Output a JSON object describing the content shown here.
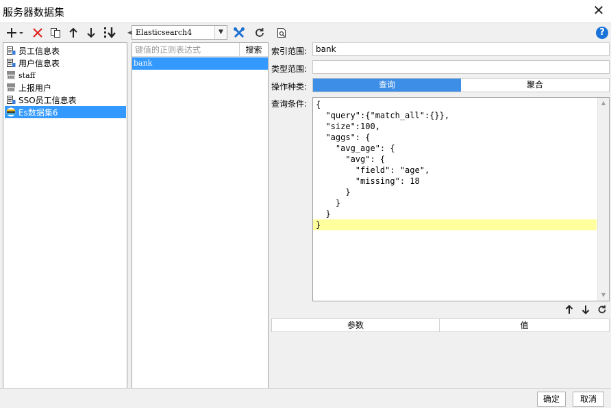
{
  "window": {
    "title": "服务器数据集"
  },
  "datasets": [
    {
      "label": "员工信息表",
      "icon": "table-icon"
    },
    {
      "label": "用户信息表",
      "icon": "table-icon"
    },
    {
      "label": "staff",
      "icon": "database-table-icon"
    },
    {
      "label": "上报用户",
      "icon": "database-table-icon"
    },
    {
      "label": "SSO员工信息表",
      "icon": "table-icon"
    },
    {
      "label": "Es数据集6",
      "icon": "elasticsearch-icon",
      "selected": true
    }
  ],
  "connection": {
    "selected": "Elasticsearch4"
  },
  "index_search": {
    "placeholder": "键值的正则表达式",
    "button": "搜索"
  },
  "indices": [
    "bank"
  ],
  "form": {
    "index_label": "索引范围:",
    "index_value": "bank",
    "type_label": "类型范围:",
    "type_value": "",
    "op_label": "操作种类:",
    "op_options": [
      "查询",
      "聚合"
    ],
    "op_selected": "查询",
    "query_label": "查询条件:"
  },
  "query_lines": [
    "{",
    "  \"query\":{\"match_all\":{}},",
    "  \"size\":100,",
    "  \"aggs\": {",
    "    \"avg_age\": {",
    "      \"avg\": {",
    "        \"field\": \"age\",",
    "        \"missing\": 18",
    "      }",
    "    }",
    "  }",
    "}"
  ],
  "params": {
    "col_param": "参数",
    "col_value": "值"
  },
  "buttons": {
    "ok": "确定",
    "cancel": "取消"
  },
  "colors": {
    "selection": "#3399ff",
    "toggle_active": "#3d8ee6",
    "line_highlight": "#ffff9e"
  }
}
